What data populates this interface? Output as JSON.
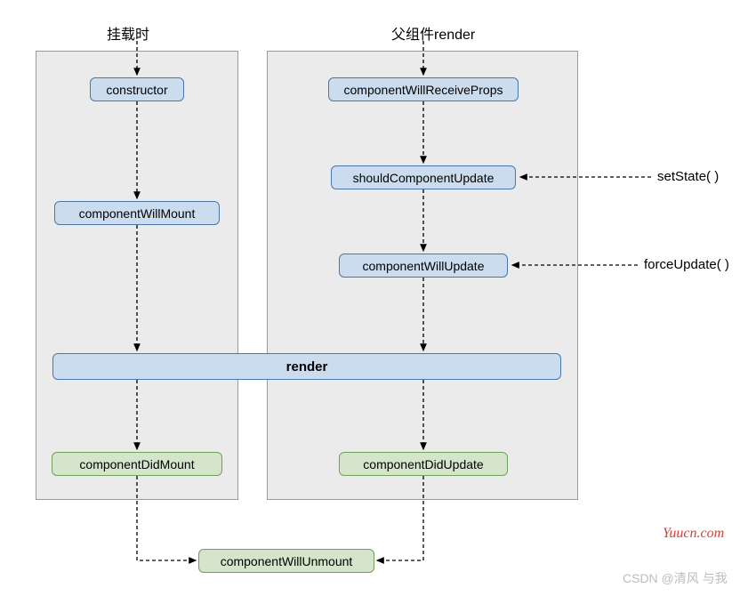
{
  "chart_data": {
    "type": "flowchart",
    "columns": [
      {
        "title": "挂载时",
        "nodes": [
          "constructor",
          "componentWillMount",
          "render",
          "componentDidMount"
        ]
      },
      {
        "title": "父组件render",
        "nodes": [
          "componentWillReceiveProps",
          "shouldComponentUpdate",
          "componentWillUpdate",
          "render",
          "componentDidUpdate"
        ]
      }
    ],
    "shared_exit": "componentWillUnmount",
    "external_triggers": [
      {
        "label": "setState( )",
        "target": "shouldComponentUpdate"
      },
      {
        "label": "forceUpdate( )",
        "target": "componentWillUpdate"
      }
    ]
  },
  "titles": {
    "left": "挂载时",
    "right": "父组件render"
  },
  "nodes": {
    "constructor": "constructor",
    "componentWillMount": "componentWillMount",
    "componentWillReceiveProps": "componentWillReceiveProps",
    "shouldComponentUpdate": "shouldComponentUpdate",
    "componentWillUpdate": "componentWillUpdate",
    "render": "render",
    "componentDidMount": "componentDidMount",
    "componentDidUpdate": "componentDidUpdate",
    "componentWillUnmount": "componentWillUnmount"
  },
  "ext": {
    "setState": "setState( )",
    "forceUpdate": "forceUpdate( )"
  },
  "watermark": {
    "red": "Yuucn.com",
    "gray": "CSDN @清风 与我"
  }
}
